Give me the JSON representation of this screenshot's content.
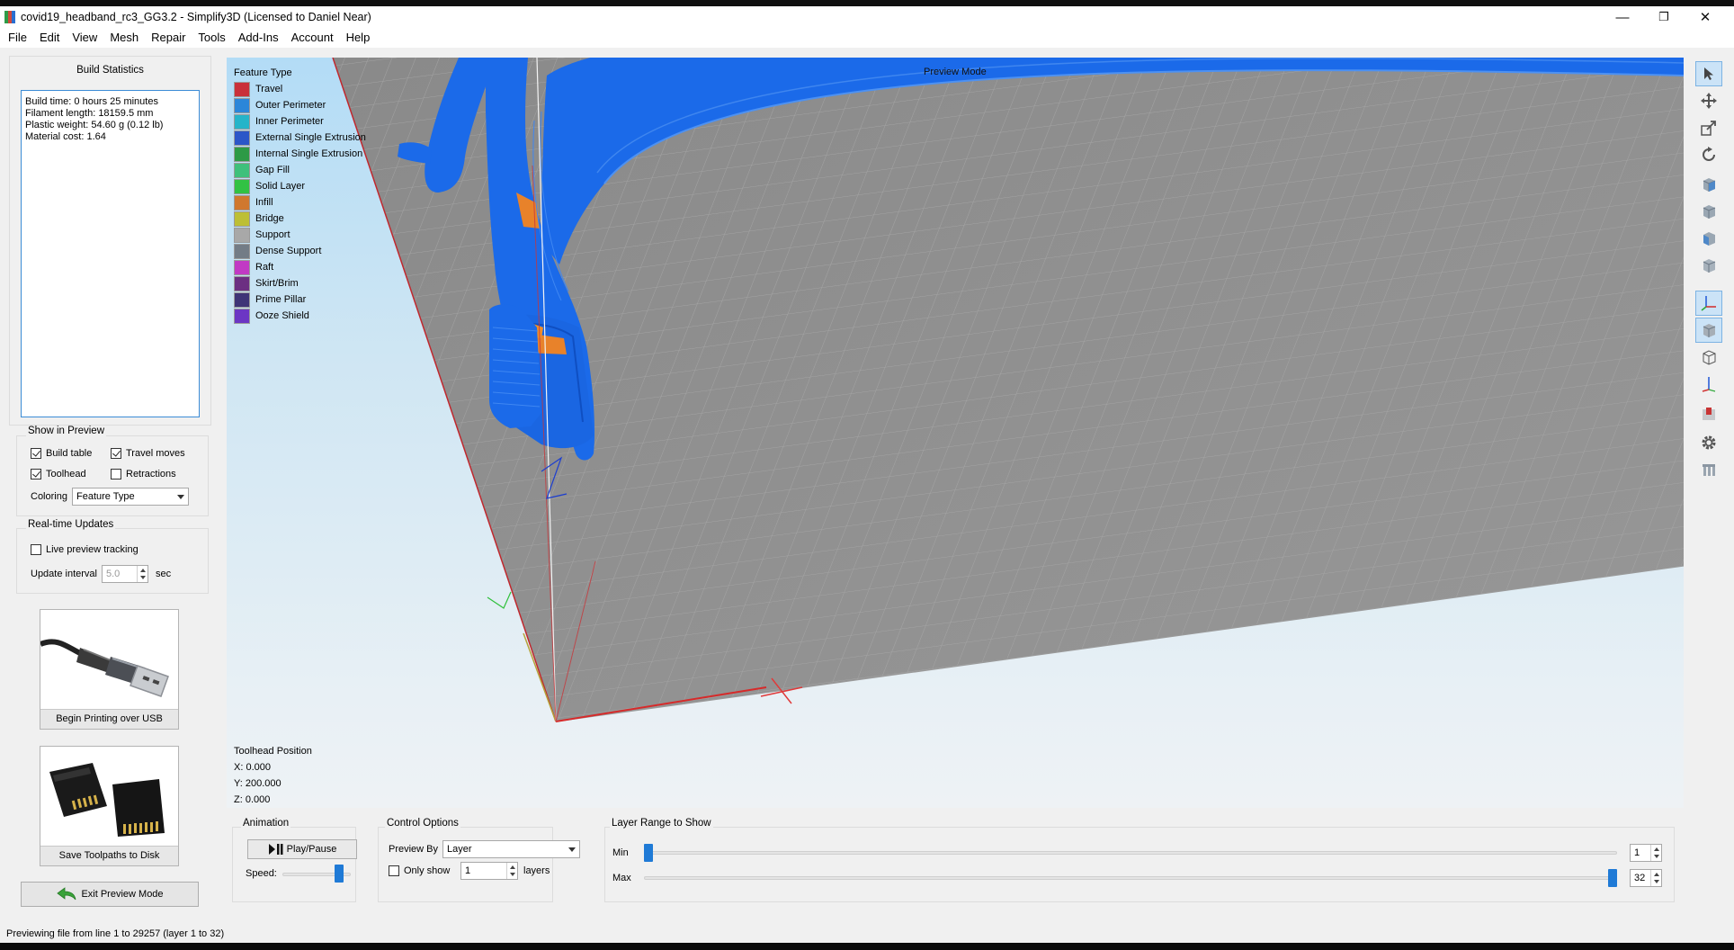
{
  "window": {
    "title": "covid19_headband_rc3_GG3.2 - Simplify3D (Licensed to Daniel Near)",
    "minimize": "—",
    "maximize": "❐",
    "close": "✕"
  },
  "menu": [
    "File",
    "Edit",
    "View",
    "Mesh",
    "Repair",
    "Tools",
    "Add-Ins",
    "Account",
    "Help"
  ],
  "build_stats": {
    "title": "Build Statistics",
    "lines": [
      "Build time: 0 hours 25 minutes",
      "Filament length: 18159.5 mm",
      "Plastic weight: 54.60 g (0.12 lb)",
      "Material cost: 1.64"
    ]
  },
  "show_in_preview": {
    "title": "Show in Preview",
    "build_table": {
      "label": "Build table",
      "checked": true
    },
    "travel_moves": {
      "label": "Travel moves",
      "checked": true
    },
    "toolhead": {
      "label": "Toolhead",
      "checked": true
    },
    "retractions": {
      "label": "Retractions",
      "checked": false
    },
    "coloring_label": "Coloring",
    "coloring_value": "Feature Type"
  },
  "realtime": {
    "title": "Real-time Updates",
    "live_tracking": {
      "label": "Live preview tracking",
      "checked": false
    },
    "update_interval_label": "Update interval",
    "update_interval_value": "5.0",
    "unit": "sec"
  },
  "actions": {
    "usb": "Begin Printing over USB",
    "disk": "Save Toolpaths to Disk",
    "exit": "Exit Preview Mode"
  },
  "viewport": {
    "legend_title": "Feature Type",
    "mode": "Preview Mode",
    "legend": [
      {
        "label": "Travel",
        "color": "#c9303a"
      },
      {
        "label": "Outer Perimeter",
        "color": "#2b86d9"
      },
      {
        "label": "Inner Perimeter",
        "color": "#25b4c9"
      },
      {
        "label": "External Single Extrusion",
        "color": "#2b56c8"
      },
      {
        "label": "Internal Single Extrusion",
        "color": "#2d9a46"
      },
      {
        "label": "Gap Fill",
        "color": "#3fc07b"
      },
      {
        "label": "Solid Layer",
        "color": "#31c244"
      },
      {
        "label": "Infill",
        "color": "#d0782e"
      },
      {
        "label": "Bridge",
        "color": "#bdbf35"
      },
      {
        "label": "Support",
        "color": "#a8a8a8"
      },
      {
        "label": "Dense Support",
        "color": "#737c86"
      },
      {
        "label": "Raft",
        "color": "#c13ac4"
      },
      {
        "label": "Skirt/Brim",
        "color": "#6c2f82"
      },
      {
        "label": "Prime Pillar",
        "color": "#3f3477"
      },
      {
        "label": "Ooze Shield",
        "color": "#6c36c4"
      }
    ],
    "toolhead": {
      "title": "Toolhead Position",
      "x": "X: 0.000",
      "y": "Y: 200.000",
      "z": "Z: 0.000"
    }
  },
  "animation": {
    "title": "Animation",
    "play": "Play/Pause",
    "speed_label": "Speed:",
    "speed_level": 0.88
  },
  "control": {
    "title": "Control Options",
    "preview_by_label": "Preview By",
    "preview_by_value": "Layer",
    "only_show": {
      "label": "Only show",
      "checked": false
    },
    "only_show_value": "1",
    "layers": "layers"
  },
  "layer_range": {
    "title": "Layer Range to Show",
    "min_label": "Min",
    "max_label": "Max",
    "min_value": "1",
    "max_value": "32",
    "min": 1,
    "max": 32,
    "total": 32
  },
  "status": "Previewing file from line 1 to 29257 (layer 1 to 32)",
  "colors": {
    "accent": "#1f7ad6",
    "part_blue": "#1c6ee8",
    "bed": "#8f8f8f"
  }
}
